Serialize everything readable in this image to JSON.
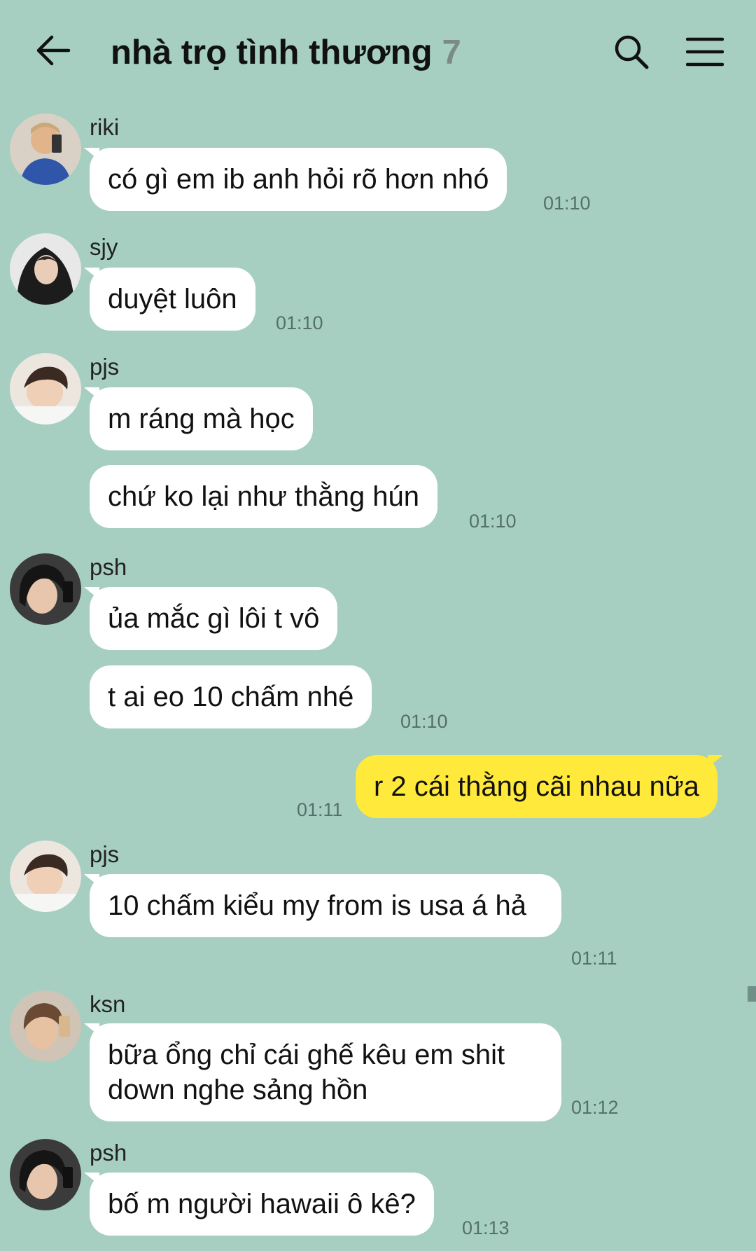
{
  "header": {
    "title": "nhà trọ tình thương",
    "member_count": "7"
  },
  "messages": [
    {
      "sender": "riki",
      "text": "có gì em ib anh hỏi rõ hơn nhó",
      "time": "01:10"
    },
    {
      "sender": "sjy",
      "text": "duyệt luôn",
      "time": "01:10"
    },
    {
      "sender": "pjs",
      "text": "m ráng mà học",
      "text2": "chứ ko lại như thằng hún",
      "time": "01:10"
    },
    {
      "sender": "psh",
      "text": "ủa mắc gì lôi t vô",
      "text2": "t ai eo 10 chấm nhé",
      "time": "01:10"
    },
    {
      "sender": "me",
      "text": "r 2 cái thằng cãi nhau nữa",
      "time": "01:11"
    },
    {
      "sender": "pjs",
      "text": "10 chấm kiểu my from is usa á hả",
      "time": "01:11"
    },
    {
      "sender": "ksn",
      "text": "bữa ổng chỉ cái ghế kêu em shit down nghe sảng hồn",
      "time": "01:12"
    },
    {
      "sender": "psh",
      "text": "bố m người hawaii ô kê?",
      "time": "01:13"
    }
  ],
  "colors": {
    "background": "#a6cfc2",
    "incoming_bubble": "#ffffff",
    "outgoing_bubble": "#ffe93a"
  },
  "icons": [
    "back-arrow-icon",
    "search-icon",
    "menu-icon"
  ]
}
